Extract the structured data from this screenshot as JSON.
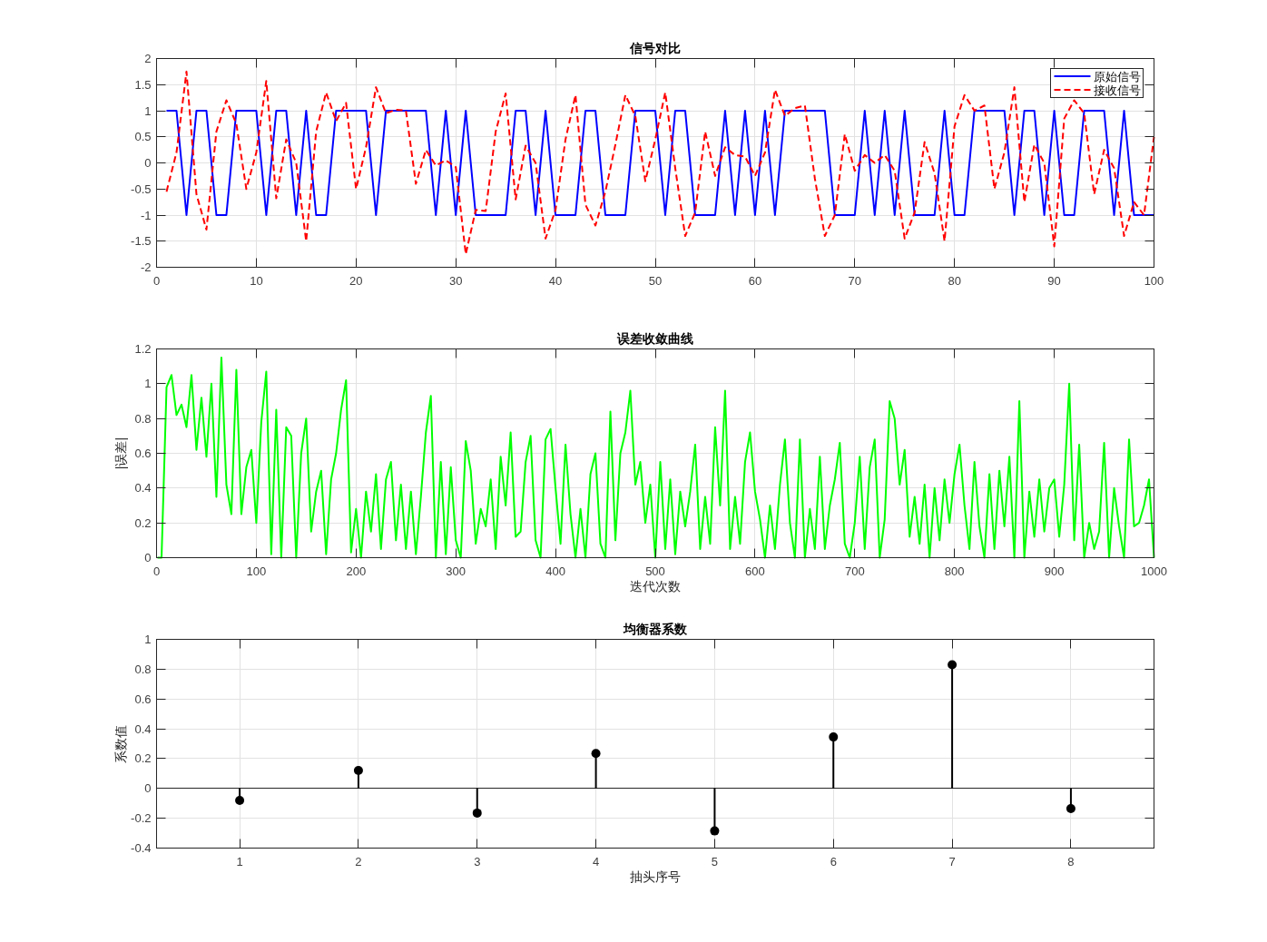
{
  "subplots": [
    {
      "chart_data": {
        "type": "line",
        "title": "信号对比",
        "grid": true,
        "legend": true,
        "xlim": [
          0,
          100
        ],
        "ylim": [
          -2,
          2
        ],
        "xticks": [
          0,
          10,
          20,
          30,
          40,
          50,
          60,
          70,
          80,
          90,
          100
        ],
        "yticks": [
          -2,
          -1.5,
          -1,
          -0.5,
          0,
          0.5,
          1,
          1.5,
          2
        ],
        "x": [
          1,
          2,
          3,
          4,
          5,
          6,
          7,
          8,
          9,
          10,
          11,
          12,
          13,
          14,
          15,
          16,
          17,
          18,
          19,
          20,
          21,
          22,
          23,
          24,
          25,
          26,
          27,
          28,
          29,
          30,
          31,
          32,
          33,
          34,
          35,
          36,
          37,
          38,
          39,
          40,
          41,
          42,
          43,
          44,
          45,
          46,
          47,
          48,
          49,
          50,
          51,
          52,
          53,
          54,
          55,
          56,
          57,
          58,
          59,
          60,
          61,
          62,
          63,
          64,
          65,
          66,
          67,
          68,
          69,
          70,
          71,
          72,
          73,
          74,
          75,
          76,
          77,
          78,
          79,
          80,
          81,
          82,
          83,
          84,
          85,
          86,
          87,
          88,
          89,
          90,
          91,
          92,
          93,
          94,
          95,
          96,
          97,
          98,
          99,
          100
        ],
        "series": [
          {
            "name": "原始信号",
            "color": "#0000ff",
            "line_style": "solid",
            "values": [
              1,
              1,
              -1,
              1,
              1,
              -1,
              -1,
              1,
              1,
              1,
              -1,
              1,
              1,
              -1,
              1,
              -1,
              -1,
              1,
              1,
              1,
              1,
              -1,
              1,
              1,
              1,
              1,
              1,
              -1,
              1,
              -1,
              1,
              -1,
              -1,
              -1,
              -1,
              1,
              1,
              -1,
              1,
              -1,
              -1,
              -1,
              1,
              1,
              -1,
              -1,
              -1,
              1,
              1,
              1,
              -1,
              1,
              1,
              -1,
              -1,
              -1,
              1,
              -1,
              1,
              -1,
              1,
              -1,
              1,
              1,
              1,
              1,
              1,
              -1,
              -1,
              -1,
              1,
              -1,
              1,
              -1,
              1,
              -1,
              -1,
              -1,
              1,
              -1,
              -1,
              1,
              1,
              1,
              1,
              -1,
              1,
              1,
              -1,
              1,
              -1,
              -1,
              1,
              1,
              1,
              -1,
              1,
              -1,
              -1,
              -1
            ]
          },
          {
            "name": "接收信号",
            "color": "#ff0000",
            "line_style": "dashed",
            "values": [
              -0.55,
              0.2,
              1.75,
              -0.6,
              -1.28,
              0.6,
              1.2,
              0.75,
              -0.5,
              0.2,
              1.57,
              -0.68,
              0.45,
              0.0,
              -1.5,
              0.6,
              1.35,
              0.8,
              1.15,
              -0.5,
              0.3,
              1.45,
              0.95,
              1.02,
              1.0,
              -0.4,
              0.25,
              -0.05,
              0.05,
              -0.08,
              -1.75,
              -0.9,
              -0.92,
              0.6,
              1.33,
              -0.7,
              0.33,
              0.0,
              -1.45,
              -0.9,
              0.45,
              1.3,
              -0.8,
              -1.2,
              -0.55,
              0.35,
              1.3,
              0.9,
              -0.35,
              0.45,
              1.35,
              -0.1,
              -1.4,
              -0.95,
              0.6,
              -0.25,
              0.3,
              0.15,
              0.12,
              -0.25,
              0.2,
              1.4,
              0.9,
              1.05,
              1.1,
              -0.3,
              -1.4,
              -1.0,
              0.55,
              -0.15,
              0.15,
              0.0,
              0.15,
              -0.15,
              -1.45,
              -0.95,
              0.4,
              -0.2,
              -1.5,
              0.7,
              1.3,
              1.0,
              1.1,
              -0.5,
              0.2,
              1.45,
              -0.75,
              0.35,
              0.0,
              -1.6,
              0.85,
              1.2,
              0.95,
              -0.6,
              0.25,
              -0.1,
              -1.4,
              -0.75,
              -1.0,
              0.5
            ]
          }
        ]
      }
    },
    {
      "chart_data": {
        "type": "line",
        "title": "误差收敛曲线",
        "grid": true,
        "xlabel": "迭代次数",
        "ylabel": "|误差|",
        "xlim": [
          0,
          1000
        ],
        "ylim": [
          0,
          1.2
        ],
        "xticks": [
          0,
          100,
          200,
          300,
          400,
          500,
          600,
          700,
          800,
          900,
          1000
        ],
        "yticks": [
          0,
          0.2,
          0.4,
          0.6,
          0.8,
          1,
          1.2
        ],
        "x": [
          1,
          5,
          10,
          15,
          20,
          25,
          30,
          35,
          40,
          45,
          50,
          55,
          60,
          65,
          70,
          75,
          80,
          85,
          90,
          95,
          100,
          105,
          110,
          115,
          120,
          125,
          130,
          135,
          140,
          145,
          150,
          155,
          160,
          165,
          170,
          175,
          180,
          185,
          190,
          195,
          200,
          205,
          210,
          215,
          220,
          225,
          230,
          235,
          240,
          245,
          250,
          255,
          260,
          265,
          270,
          275,
          280,
          285,
          290,
          295,
          300,
          305,
          310,
          315,
          320,
          325,
          330,
          335,
          340,
          345,
          350,
          355,
          360,
          365,
          370,
          375,
          380,
          385,
          390,
          395,
          400,
          405,
          410,
          415,
          420,
          425,
          430,
          435,
          440,
          445,
          450,
          455,
          460,
          465,
          470,
          475,
          480,
          485,
          490,
          495,
          500,
          505,
          510,
          515,
          520,
          525,
          530,
          535,
          540,
          545,
          550,
          555,
          560,
          565,
          570,
          575,
          580,
          585,
          590,
          595,
          600,
          605,
          610,
          615,
          620,
          625,
          630,
          635,
          640,
          645,
          650,
          655,
          660,
          665,
          670,
          675,
          680,
          685,
          690,
          695,
          700,
          705,
          710,
          715,
          720,
          725,
          730,
          735,
          740,
          745,
          750,
          755,
          760,
          765,
          770,
          775,
          780,
          785,
          790,
          795,
          800,
          805,
          810,
          815,
          820,
          825,
          830,
          835,
          840,
          845,
          850,
          855,
          860,
          865,
          870,
          875,
          880,
          885,
          890,
          895,
          900,
          905,
          910,
          915,
          920,
          925,
          930,
          935,
          940,
          945,
          950,
          955,
          960,
          965,
          970,
          975,
          980,
          985,
          990,
          995,
          1000
        ],
        "series": [
          {
            "color": "#00ff00",
            "line_style": "solid",
            "values": [
              0,
              0,
              0.98,
              1.05,
              0.82,
              0.88,
              0.75,
              1.05,
              0.62,
              0.92,
              0.58,
              1.0,
              0.35,
              1.15,
              0.42,
              0.25,
              1.08,
              0.25,
              0.52,
              0.62,
              0.2,
              0.78,
              1.07,
              0.02,
              0.85,
              0.0,
              0.75,
              0.7,
              0.0,
              0.6,
              0.8,
              0.15,
              0.38,
              0.5,
              0.02,
              0.45,
              0.6,
              0.85,
              1.02,
              0.03,
              0.28,
              0.0,
              0.38,
              0.15,
              0.48,
              0.05,
              0.45,
              0.55,
              0.1,
              0.42,
              0.05,
              0.38,
              0.02,
              0.35,
              0.72,
              0.93,
              0.0,
              0.55,
              0.02,
              0.52,
              0.1,
              0.0,
              0.67,
              0.5,
              0.08,
              0.28,
              0.18,
              0.45,
              0.05,
              0.58,
              0.3,
              0.72,
              0.12,
              0.15,
              0.55,
              0.7,
              0.1,
              0.0,
              0.68,
              0.74,
              0.4,
              0.08,
              0.65,
              0.25,
              0.0,
              0.28,
              0.0,
              0.48,
              0.6,
              0.08,
              0.0,
              0.84,
              0.1,
              0.6,
              0.72,
              0.96,
              0.42,
              0.55,
              0.2,
              0.42,
              0.0,
              0.55,
              0.05,
              0.45,
              0.02,
              0.38,
              0.18,
              0.38,
              0.65,
              0.05,
              0.35,
              0.08,
              0.75,
              0.3,
              0.96,
              0.05,
              0.35,
              0.08,
              0.55,
              0.72,
              0.38,
              0.22,
              0.0,
              0.3,
              0.05,
              0.42,
              0.68,
              0.2,
              0.0,
              0.68,
              0.0,
              0.28,
              0.05,
              0.58,
              0.05,
              0.3,
              0.45,
              0.66,
              0.08,
              0.0,
              0.2,
              0.58,
              0.05,
              0.52,
              0.68,
              0.0,
              0.22,
              0.9,
              0.8,
              0.42,
              0.62,
              0.12,
              0.35,
              0.08,
              0.42,
              0.0,
              0.4,
              0.1,
              0.45,
              0.2,
              0.48,
              0.65,
              0.3,
              0.05,
              0.55,
              0.18,
              0.0,
              0.48,
              0.05,
              0.5,
              0.18,
              0.58,
              0.0,
              0.9,
              0.0,
              0.38,
              0.12,
              0.45,
              0.15,
              0.4,
              0.45,
              0.12,
              0.42,
              1.0,
              0.1,
              0.65,
              0.0,
              0.2,
              0.05,
              0.15,
              0.66,
              0.0,
              0.4,
              0.18,
              0.0,
              0.68,
              0.18,
              0.2,
              0.3,
              0.45,
              0.0
            ]
          }
        ]
      }
    },
    {
      "chart_data": {
        "type": "scatter",
        "title": "均衡器系数",
        "grid": true,
        "xlabel": "抽头序号",
        "ylabel": "系数值",
        "xlim": [
          0.3,
          8.7
        ],
        "ylim": [
          -0.4,
          1
        ],
        "xticks": [
          1,
          2,
          3,
          4,
          5,
          6,
          7,
          8
        ],
        "yticks": [
          -0.4,
          -0.2,
          0,
          0.2,
          0.4,
          0.6,
          0.8,
          1
        ],
        "x": [
          1,
          2,
          3,
          4,
          5,
          6,
          7,
          8
        ],
        "series": [
          {
            "color": "#000000",
            "values": [
              -0.08,
              0.12,
              -0.165,
              0.235,
              -0.285,
              0.345,
              0.83,
              -0.135
            ]
          }
        ]
      }
    }
  ]
}
